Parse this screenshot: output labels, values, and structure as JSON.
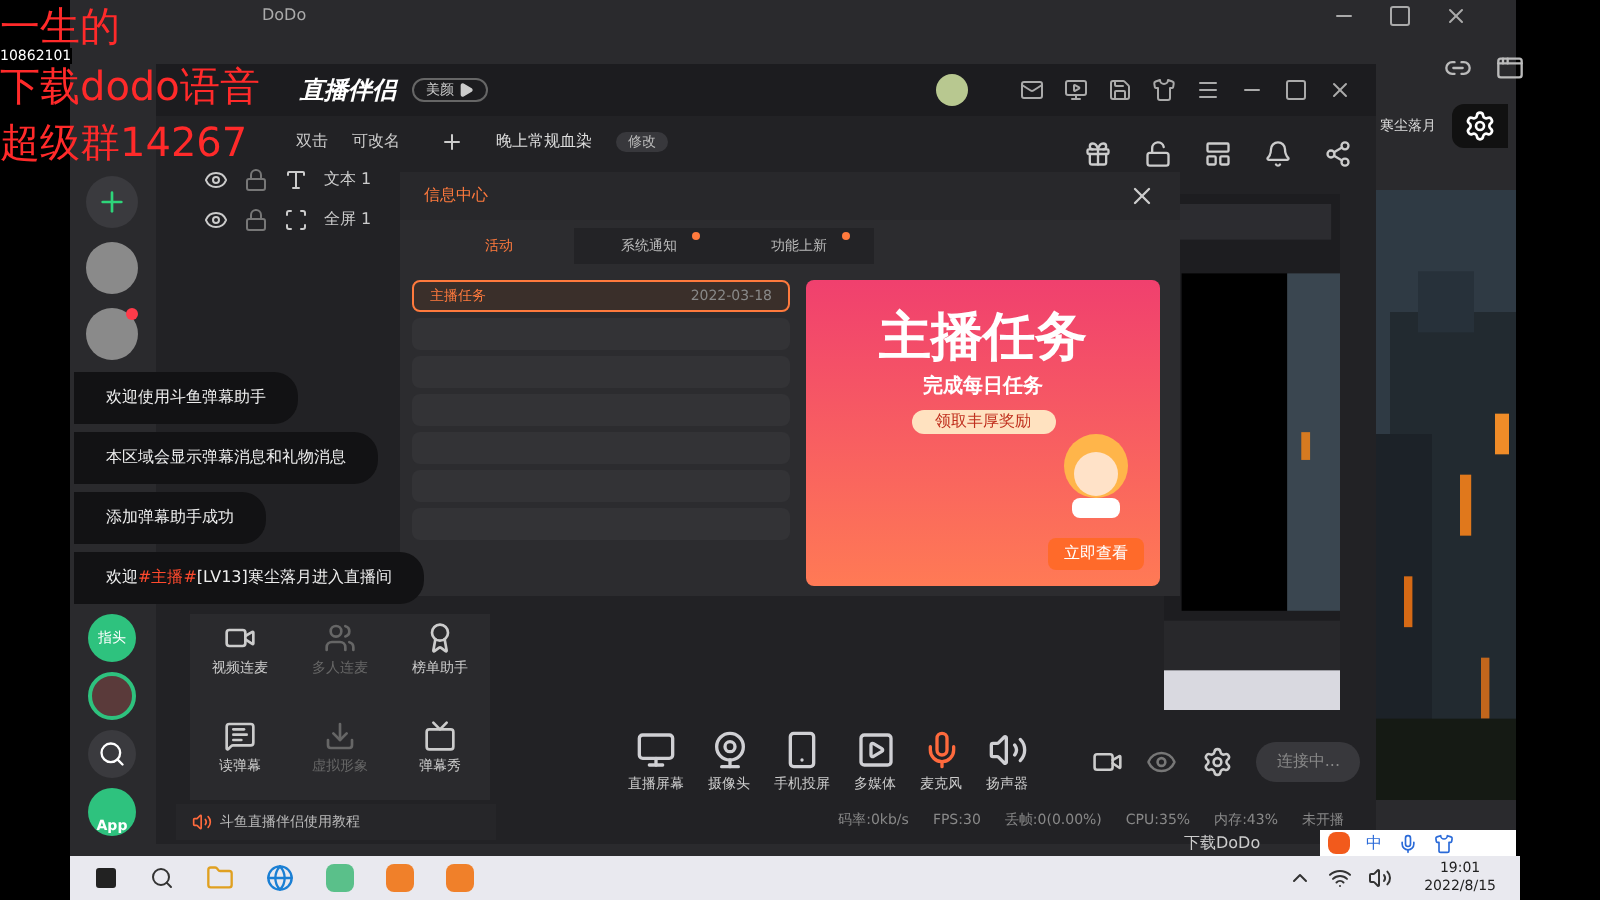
{
  "overlay": {
    "id_text": "10862101",
    "lines": [
      "一生的",
      "下载dodo语音",
      "超级群14267"
    ]
  },
  "dodo": {
    "title": "DoDo",
    "rail": [
      {
        "kind": "plus"
      },
      {
        "kind": "avatar",
        "badge": false
      },
      {
        "kind": "avatar",
        "badge": true
      },
      {
        "kind": "pill",
        "label": "指头"
      },
      {
        "kind": "ring"
      },
      {
        "kind": "search"
      },
      {
        "kind": "app",
        "label": "App"
      }
    ],
    "nickname": "寒尘落月",
    "float_text": "下载DoDo"
  },
  "studio": {
    "logo": "直播伴侣",
    "beauty": "美颜",
    "scene_tabs": [
      "双击",
      "可改名"
    ],
    "scene_name": "晚上常规血染",
    "edit": "修改",
    "layers": [
      {
        "label": "文本 1",
        "kind": "text"
      },
      {
        "label": "全屏 1",
        "kind": "screen"
      }
    ],
    "tools": [
      {
        "label": "视频连麦",
        "disabled": false
      },
      {
        "label": "多人连麦",
        "disabled": true
      },
      {
        "label": "榜单助手",
        "disabled": false
      },
      {
        "label": "读弹幕",
        "disabled": false
      },
      {
        "label": "虚拟形象",
        "disabled": true
      },
      {
        "label": "弹幕秀",
        "disabled": false
      }
    ],
    "tutorial": "斗鱼直播伴侣使用教程",
    "toolbar": [
      {
        "label": "直播屏幕",
        "kind": "screen"
      },
      {
        "label": "摄像头",
        "kind": "camera"
      },
      {
        "label": "手机投屏",
        "kind": "phone"
      },
      {
        "label": "多媒体",
        "kind": "media"
      },
      {
        "label": "麦克风",
        "kind": "mic"
      },
      {
        "label": "扬声器",
        "kind": "speaker"
      }
    ],
    "connect": "连接中...",
    "status": [
      "码率:0kb/s",
      "FPS:30",
      "丢帧:0(0.00%)",
      "CPU:35%",
      "内存:43%",
      "未开播"
    ]
  },
  "messages": {
    "title": "信息中心",
    "tabs": [
      {
        "label": "活动",
        "selected": true,
        "dot": false
      },
      {
        "label": "系统通知",
        "selected": false,
        "dot": true
      },
      {
        "label": "功能上新",
        "selected": false,
        "dot": true
      }
    ],
    "items": [
      {
        "title": "主播任务",
        "date": "2022-03-18",
        "selected": true
      }
    ],
    "banner": {
      "title": "主播任务",
      "subtitle": "完成每日任务",
      "ribbon": "领取丰厚奖励",
      "button": "立即查看"
    }
  },
  "chat": [
    {
      "segments": [
        {
          "text": "欢迎使用斗鱼弹幕助手",
          "highlight": false
        }
      ]
    },
    {
      "segments": [
        {
          "text": "本区域会显示弹幕消息和礼物消息",
          "highlight": false
        }
      ]
    },
    {
      "segments": [
        {
          "text": "添加弹幕助手成功",
          "highlight": false
        }
      ]
    },
    {
      "segments": [
        {
          "text": "欢迎",
          "highlight": false
        },
        {
          "text": "#主播#",
          "highlight": true
        },
        {
          "text": "[LV13]寒尘落月进入直播间",
          "highlight": false
        }
      ]
    }
  ],
  "taskbar": {
    "time": "19:01",
    "date": "2022/8/15",
    "ime": "中"
  }
}
